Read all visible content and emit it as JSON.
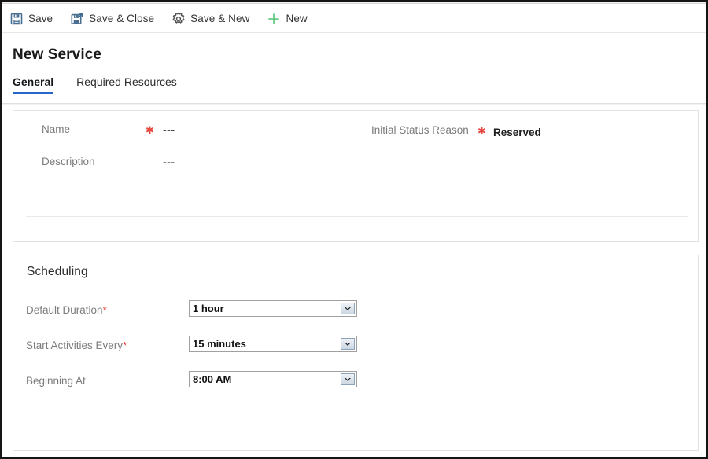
{
  "window": {
    "title": "New Service"
  },
  "commandbar": {
    "buttons": [
      {
        "label": "Save",
        "icon": "save-floppy-icon"
      },
      {
        "label": "Save & Close",
        "icon": "save-and-close-floppy-icon"
      },
      {
        "label": "Save & New",
        "icon": "save-and-new-gear-icon"
      },
      {
        "label": "New",
        "icon": "plus-icon"
      }
    ]
  },
  "header": {
    "page_title": "New Service",
    "tabs": [
      {
        "label": "General",
        "active": true
      },
      {
        "label": "Required Resources",
        "active": false
      }
    ]
  },
  "general_section": {
    "fields": [
      {
        "label": "Name",
        "required": true,
        "value": "---"
      },
      {
        "label": "Description",
        "required": false,
        "value": "---"
      },
      {
        "label": "Initial Status Reason",
        "required": true,
        "value": "Reserved"
      }
    ]
  },
  "scheduling_section": {
    "title": "Scheduling",
    "fields": [
      {
        "label": "Default Duration",
        "required": true,
        "value": "1 hour"
      },
      {
        "label": "Start Activities Every",
        "required": true,
        "value": "15 minutes"
      },
      {
        "label": "Beginning At",
        "required": false,
        "value": "8:00 AM"
      }
    ]
  },
  "colors": {
    "accent_tab": "#2566c9",
    "required_star": "#e8483f",
    "new_icon_green": "#5fc77f",
    "save_icon_blue": "#4a6f92",
    "label_gray": "#7a7a7a"
  }
}
